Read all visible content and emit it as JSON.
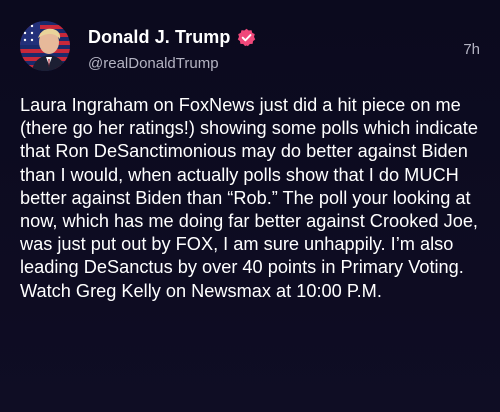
{
  "author": {
    "display_name": "Donald J. Trump",
    "handle": "@realDonaldTrump",
    "verified": true
  },
  "post": {
    "timestamp": "7h",
    "text": "Laura Ingraham on FoxNews just did a hit piece on me (there go her ratings!) showing some polls which indicate that Ron DeSanctimonious may do better against Biden than I would, when actually polls show that I do MUCH better against Biden than “Rob.” The poll your looking at now, which has me doing far better against Crooked Joe, was just put out by FOX, I am sure unhappily. I’m also leading DeSanctus by over 40 points in Primary Voting. Watch Greg Kelly on Newsmax at 10:00 P.M."
  },
  "colors": {
    "background": "#0c0b1c",
    "verified_badge": "#f0487a",
    "secondary_text": "#b4b3c2"
  },
  "icons": {
    "avatar": "profile-avatar",
    "verified": "verified-badge-icon"
  }
}
